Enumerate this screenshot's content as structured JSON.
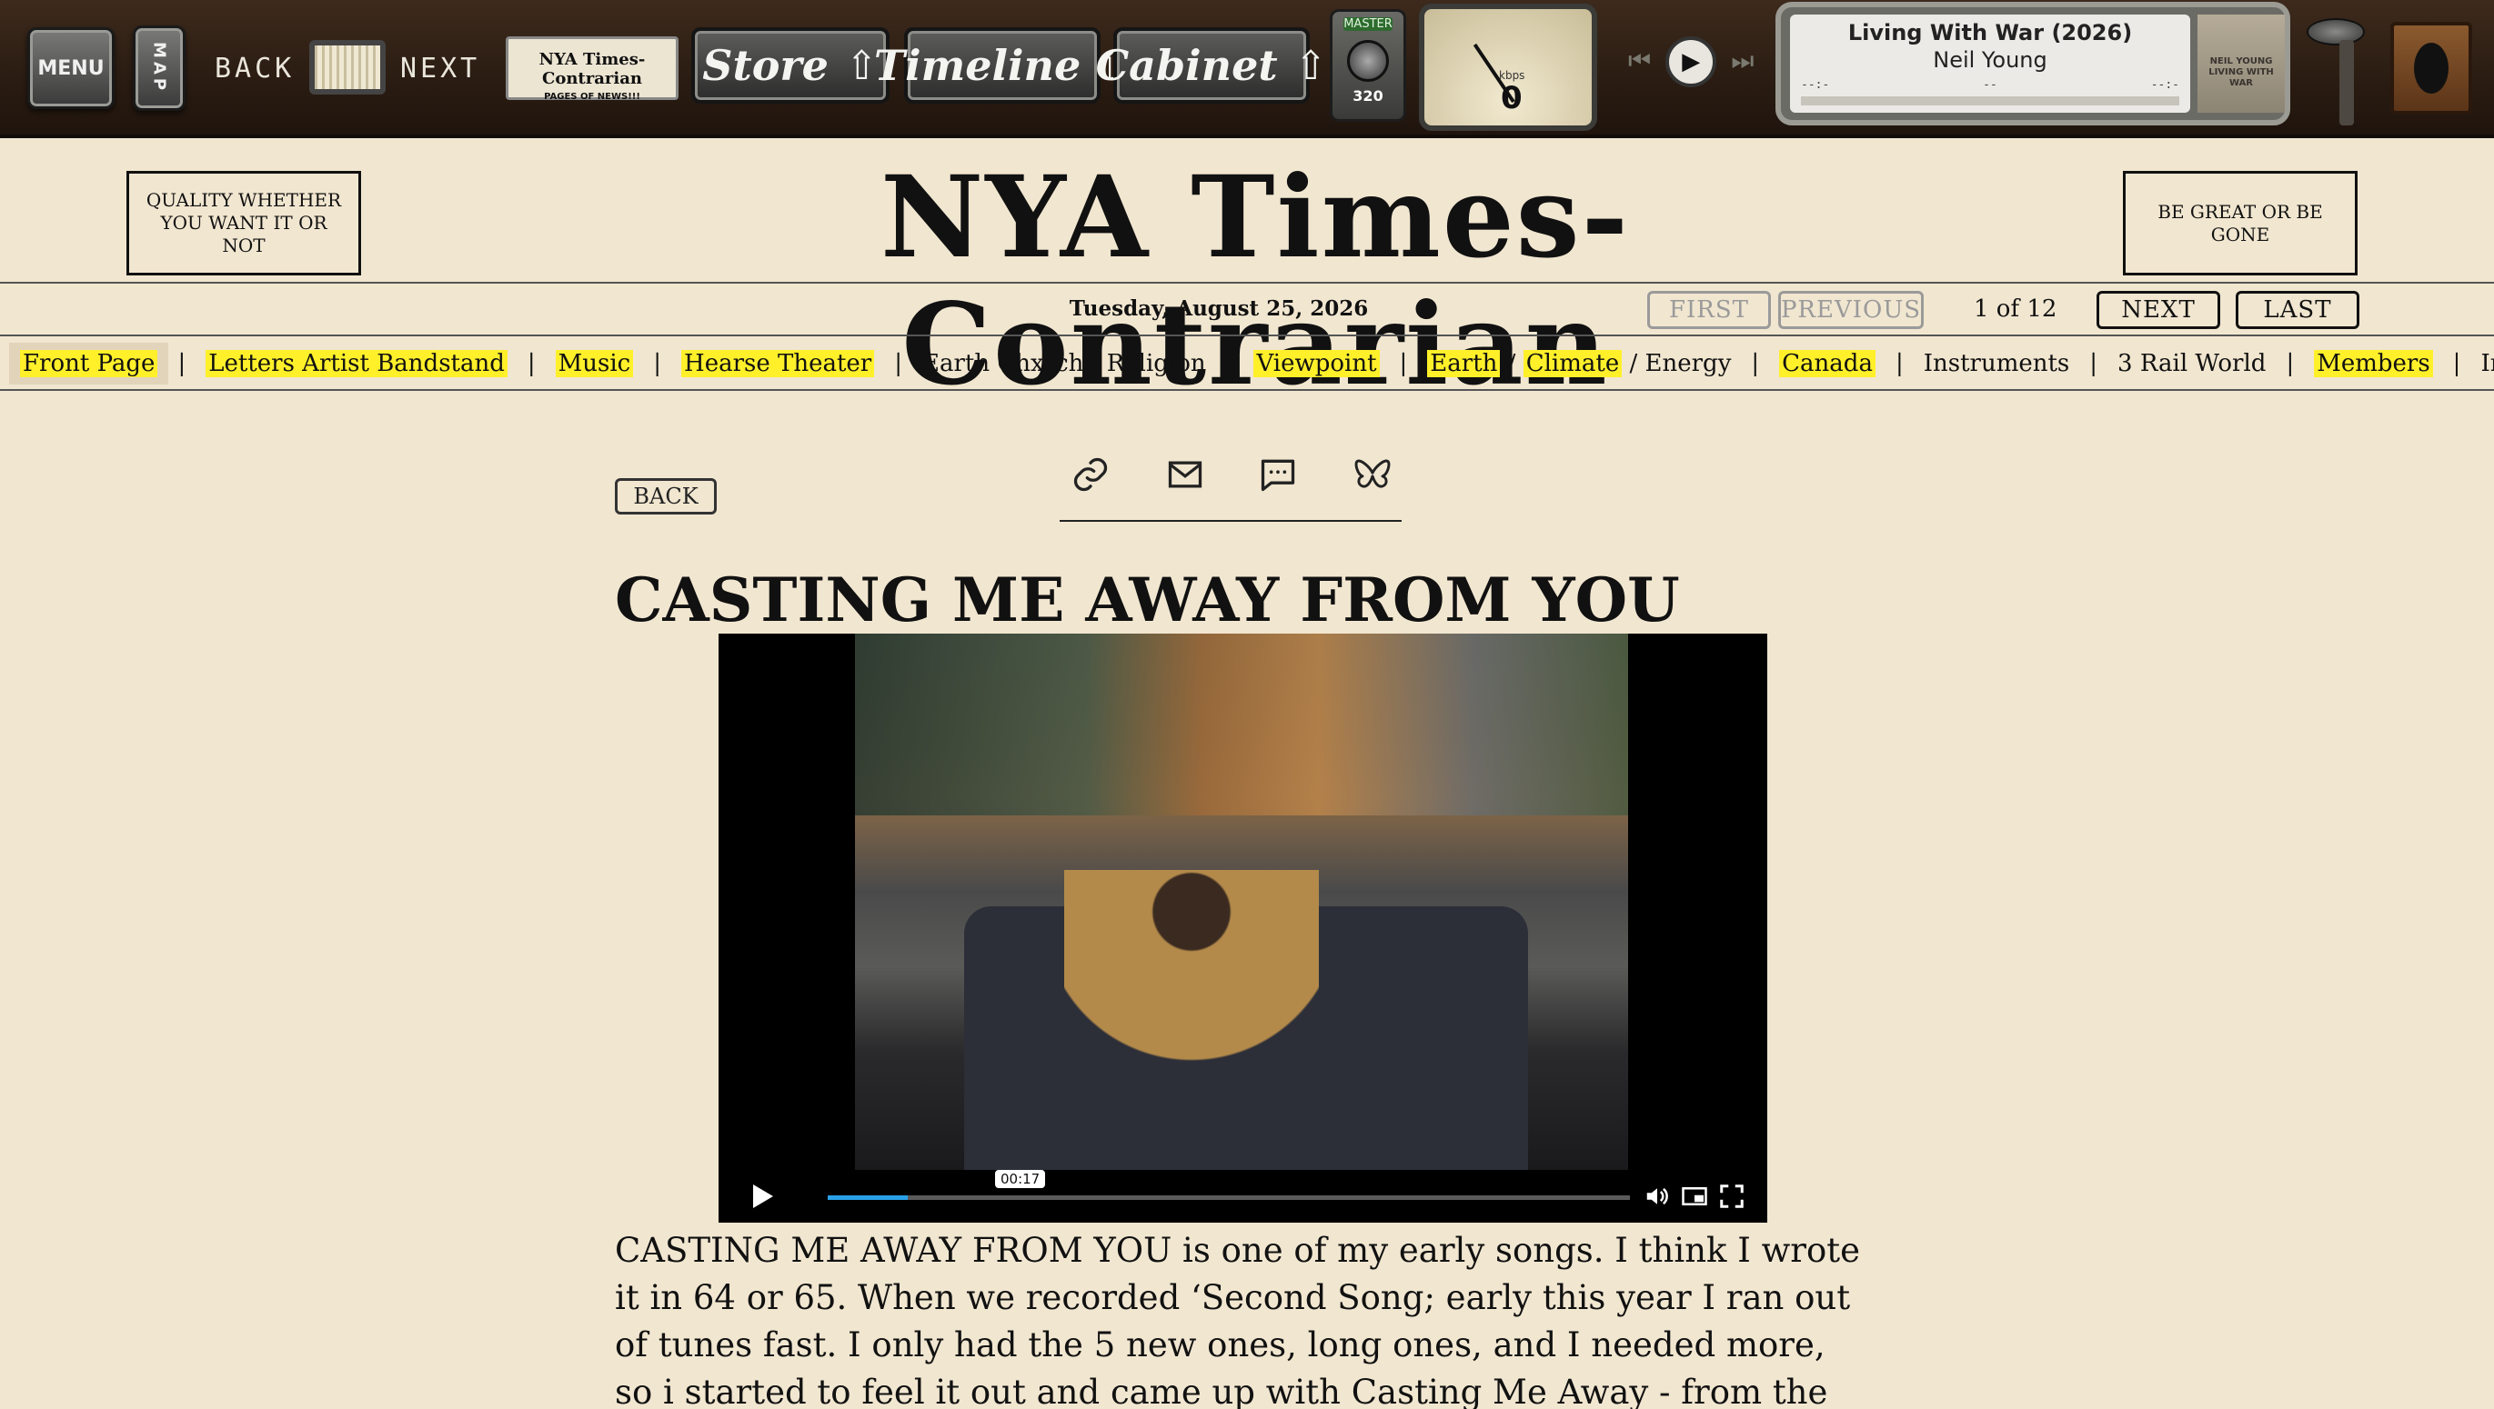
{
  "toolbar": {
    "menu_label": "MENU",
    "map_label": "MAP",
    "back_label": "BACK",
    "next_label": "NEXT",
    "paper_title": "NYA Times-Contrarian",
    "paper_subtitle": "PAGES OF NEWS!!!",
    "store_label": "Store",
    "timeline_label": "Timeline",
    "cabinet_label": "Cabinet",
    "master_label": "MASTER",
    "master_value": "320",
    "gauge_unit": "kbps",
    "gauge_value": "0",
    "now_playing": {
      "title": "Living With War (2026)",
      "artist": "Neil Young",
      "time_left": "--:-",
      "time_mid": "--",
      "time_right": "--:-",
      "cover_text": "NEIL YOUNG LIVING WITH WAR"
    },
    "icons": [
      "menu-icon",
      "map-icon",
      "store-arrow-icon",
      "timeline-arrow-icon",
      "cabinet-arrow-icon",
      "prev-track-icon",
      "play-icon",
      "next-track-icon",
      "ufo-icon",
      "keyhole-icon"
    ]
  },
  "masthead": {
    "title": "NYA  Times-Contrarian",
    "left_box": "QUALITY WHETHER YOU WANT IT OR NOT",
    "right_box": "BE GREAT OR BE GONE"
  },
  "dateline": {
    "date": "Tuesday, August 25, 2026",
    "first_label": "FIRST",
    "previous_label": "PREVIOUS",
    "page_count": "1 of 12",
    "next_label": "NEXT",
    "last_label": "LAST"
  },
  "nav": {
    "front_page": "Front Page",
    "letters": "Letters Artist Bandstand",
    "music": "Music",
    "hearse": "Hearse Theater",
    "earth_church": "Earth Chxrch / Religion",
    "viewpoint": "Viewpoint",
    "earth": "Earth",
    "climate": "Climate",
    "energy": "Energy",
    "canada": "Canada",
    "instruments": "Instruments",
    "rail": "3 Rail World",
    "members": "Members",
    "inside": "Inside NYA",
    "separator": "|",
    "slash": "/"
  },
  "article": {
    "back_label": "BACK",
    "share_icons": [
      "link-icon",
      "mail-icon",
      "comment-icon",
      "butterfly-icon"
    ],
    "headline": "CASTING ME AWAY FROM YOU",
    "video": {
      "time_tooltip": "00:17",
      "progress_fraction": 0.1,
      "icons": [
        "video-play-icon",
        "volume-icon",
        "picture-in-picture-icon",
        "fullscreen-icon"
      ]
    },
    "body": "CASTING ME AWAY FROM YOU is one of my early songs. I think I wrote it in 64 or 65. When we recorded ‘Second Song; early this year I ran out of tunes fast. I only had the 5 new ones, long ones, and I needed more, so i started to feel it out and came up with Casting Me Away - from the deep past. There is an old recording with"
  },
  "colors": {
    "paper": "#f1e6d0",
    "highlight": "#fff02a",
    "toolbar": "#2a1c12",
    "video_progress": "#2aa0e8"
  }
}
